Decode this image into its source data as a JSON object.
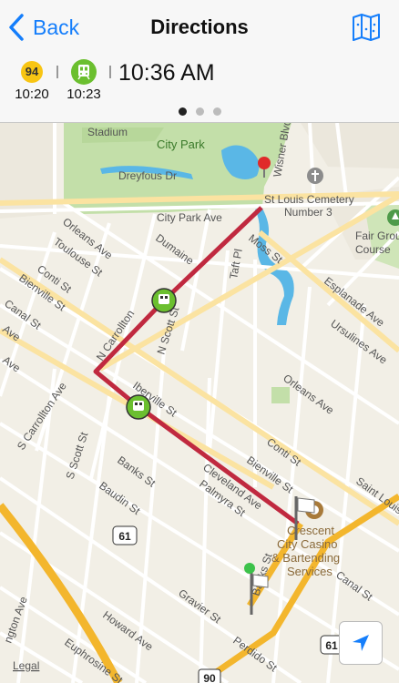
{
  "nav": {
    "back_label": "Back",
    "title": "Directions"
  },
  "steps": [
    {
      "type": "bus",
      "route": "94",
      "time": "10:20",
      "color": "#f8c513"
    },
    {
      "type": "tram",
      "time": "10:23",
      "color": "#6bbf2f"
    }
  ],
  "arrival_time": "10:36 AM",
  "pager": {
    "count": 3,
    "active": 0
  },
  "map": {
    "labels": {
      "stadium": "Stadium",
      "city_park": "City Park",
      "dreyfous_dr": "Dreyfous Dr",
      "city_park_ave": "City Park Ave",
      "wisner_blvd": "Wisner Blvd",
      "cemetery_1": "St Louis Cemetery",
      "cemetery_2": "Number 3",
      "fair_1": "Fair Grou",
      "fair_2": "Course",
      "esplanade_ave": "Esplanade Ave",
      "orleans_ave_1": "Orleans Ave",
      "orleans_ave_2": "Orleans Ave",
      "toulouse_st": "Toulouse St",
      "dumaine": "Dumaine",
      "conti_st_1": "Conti St",
      "conti_st_2": "Conti St",
      "bienville_st_1": "Bienville St",
      "bienville_st_2": "Bienville St",
      "taft_pl": "Taft Pl",
      "moss_st": "Moss St",
      "ursulines_ave": "Ursulines Ave",
      "canal_st_1": "Canal St",
      "canal_st_2": "Canal St",
      "n_carrollton": "N Carrollton",
      "n_scott_st": "N Scott St",
      "iberville_st": "Iberville St",
      "s_carrollton_ave": "S Carrollton Ave",
      "s_scott_st": "S Scott St",
      "baudin_st": "Baudin St",
      "banks_st_1": "Banks St",
      "banks_st_2": "Banks St",
      "cleveland_ave": "Cleveland Ave",
      "palmyra_st": "Palmyra St",
      "saint_louis": "Saint Louis",
      "casino_1": "Crescent",
      "casino_2": "City Casino",
      "casino_3": "& Bartending",
      "casino_4": "Services",
      "gravier_st": "Gravier St",
      "howard_ave": "Howard Ave",
      "euphrosine_st": "Euphrosine St",
      "perdido_st": "Perdido St",
      "ngton_ave": "ngton Ave",
      "ave_1": "Ave",
      "ave_2": "Ave",
      "hwy_61_a": "61",
      "hwy_61_b": "61",
      "hwy_90": "90"
    },
    "legal": "Legal",
    "colors": {
      "route": "#c0293f",
      "highway": "#f3b62d",
      "park": "#c3dfa9",
      "water": "#5ab7e6"
    }
  }
}
